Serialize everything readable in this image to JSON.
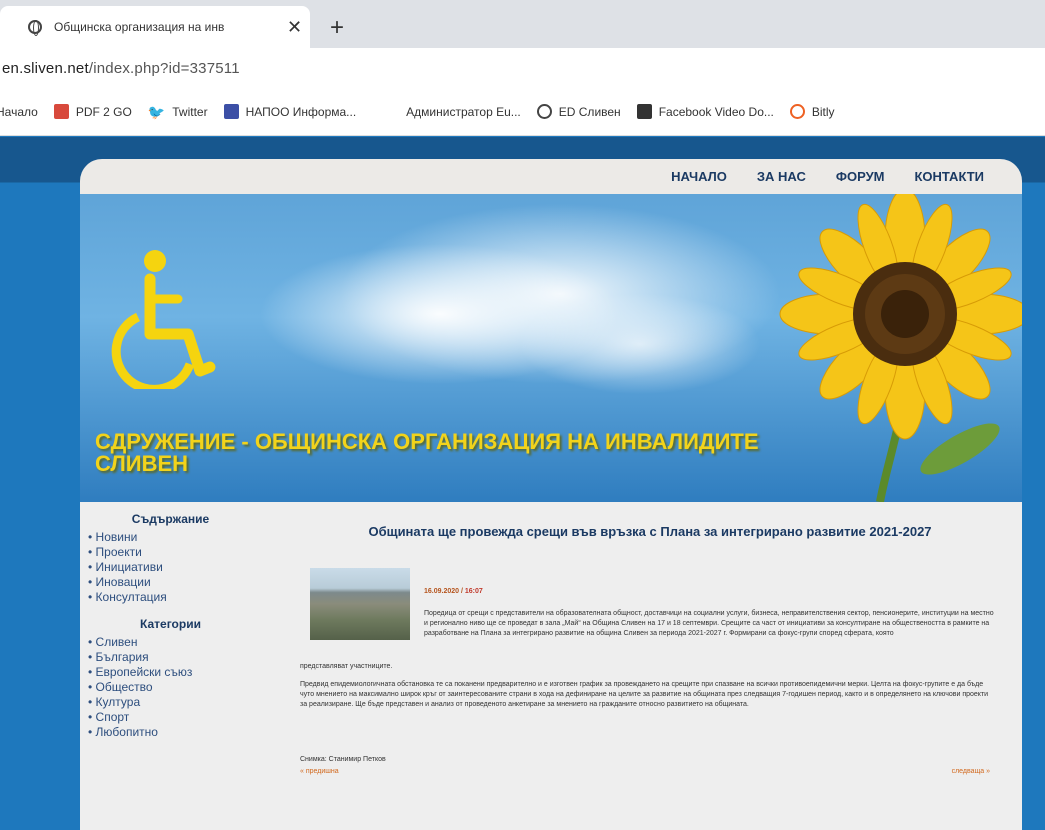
{
  "browser": {
    "tab_title": "Общинска организация на инв",
    "url_prefix": "en.sliven.net",
    "url_rest": "/index.php?id=337511",
    "bookmarks": [
      {
        "label": "Начало",
        "icon": "none"
      },
      {
        "label": "PDF 2 GO",
        "icon": "pdf2go-icon"
      },
      {
        "label": "Twitter",
        "icon": "twitter-icon"
      },
      {
        "label": "НАПОО Информа...",
        "icon": "napoo-icon"
      },
      {
        "label": "Администратор Еu...",
        "icon": "none"
      },
      {
        "label": "ED Сливен",
        "icon": "globe-icon"
      },
      {
        "label": "Facebook Video Do...",
        "icon": "facebook-video-icon"
      },
      {
        "label": "Bitly",
        "icon": "bitly-icon"
      }
    ]
  },
  "nav": [
    "НАЧАЛО",
    "ЗА НАС",
    "ФОРУМ",
    "КОНТАКТИ"
  ],
  "banner": {
    "title_line1": "СДРУЖЕНИЕ - ОБЩИНСКА ОРГАНИЗАЦИЯ НА ИНВАЛИДИТЕ",
    "title_line2": "СЛИВЕН"
  },
  "sidebar": {
    "contents_heading": "Съдържание",
    "contents": [
      "Новини",
      "Проекти",
      "Инициативи",
      "Иновации",
      "Консултация"
    ],
    "categories_heading": "Категории",
    "categories": [
      "Сливен",
      "България",
      "Европейски съюз",
      "Общество",
      "Култура",
      "Спорт",
      "Любопитно"
    ]
  },
  "article": {
    "title": "Общината ще провежда срещи във връзка с Плана за интегрирано развитие 2021-2027",
    "date": "16.09.2020",
    "time": "16:07",
    "p1": "Поредица от срещи с представители на образователната общност, доставчици на социални услуги, бизнеса, неправителствения сектор, пенсионерите, институции на местно и регионално ниво ще се проведат в зала „Май“ на Община Сливен на 17 и 18 септември. Срещите са част от инициативи за консултиране на обществеността в рамките на разработване на Плана за интегрирано развитие на община Сливен за периода 2021-2027 г. Формирани са фокус-групи според сферата, която",
    "p1b": "представляват участниците.",
    "p2": "Предвид епидемиологичната обстановка те са поканени предварително и е изготвен график за провеждането на срещите при спазване на всички противоепидемични мерки. Целта на фокус-групите е да бъде чуто мнението на максимално широк кръг от заинтересованите страни в хода на дефиниране на целите за развитие на общината през следващия 7-годишен период, както и в определянето на ключови проекти за реализиране. Ще бъде представен и анализ от проведеното анкетиране за мнението на гражданите относно развитието на общината.",
    "photo_credit": "Снимка: Станимир Петков",
    "prev": "« предишна",
    "next": "следваща »"
  }
}
